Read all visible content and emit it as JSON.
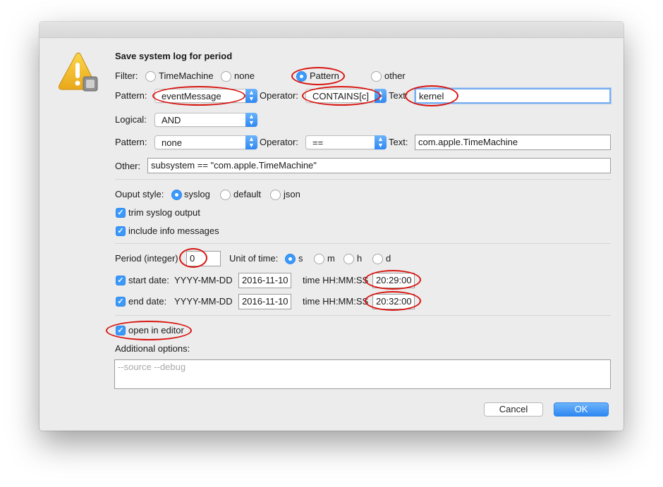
{
  "dialog": {
    "title": "Save system log for period"
  },
  "filter": {
    "label": "Filter:",
    "options": [
      "TimeMachine",
      "none",
      "Pattern",
      "other"
    ],
    "selected": "Pattern"
  },
  "row1": {
    "pattern_label": "Pattern:",
    "pattern_value": "eventMessage",
    "operator_label": "Operator:",
    "operator_value": "CONTAINS[c]",
    "text_label": "Text:",
    "text_value": "kernel"
  },
  "logical": {
    "label": "Logical:",
    "value": "AND"
  },
  "row2": {
    "pattern_label": "Pattern:",
    "pattern_value": "none",
    "operator_label": "Operator:",
    "operator_value": "==",
    "text_label": "Text:",
    "text_value": "com.apple.TimeMachine"
  },
  "other": {
    "label": "Other:",
    "value": "subsystem == \"com.apple.TimeMachine\""
  },
  "output": {
    "label": "Ouput style:",
    "options": [
      "syslog",
      "default",
      "json"
    ],
    "selected": "syslog",
    "trim_label": "trim syslog output",
    "info_label": "include info messages"
  },
  "period": {
    "label": "Period (integer)",
    "value": "0",
    "unit_label": "Unit of time:",
    "units": [
      "s",
      "m",
      "h",
      "d"
    ],
    "selected_unit": "s"
  },
  "start": {
    "label": "start date:",
    "format": "YYYY-MM-DD",
    "date": "2016-11-10",
    "time_label": "time HH:MM:SS",
    "time": "20:29:00"
  },
  "end": {
    "label": "end date:",
    "format": "YYYY-MM-DD",
    "date": "2016-11-10",
    "time_label": "time HH:MM:SS",
    "time": "20:32:00"
  },
  "editor": {
    "open_label": "open in editor"
  },
  "additional": {
    "label": "Additional options:",
    "placeholder": "--source --debug"
  },
  "buttons": {
    "cancel": "Cancel",
    "ok": "OK"
  },
  "colors": {
    "accent": "#3b99fc",
    "annotation": "#d8140f",
    "warning": "#f5c22b"
  }
}
